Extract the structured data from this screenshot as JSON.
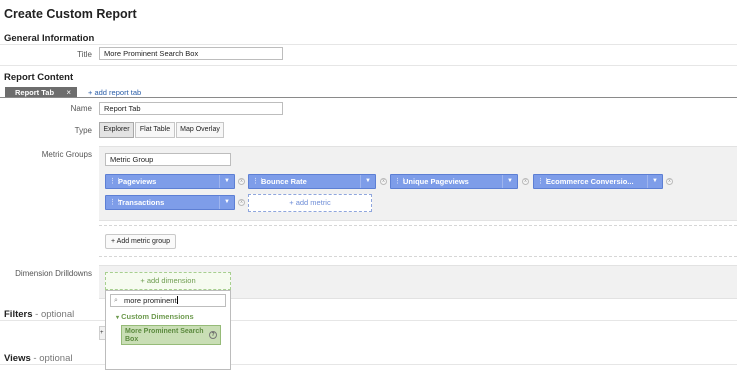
{
  "page": {
    "title": "Create Custom Report"
  },
  "general": {
    "heading": "General Information",
    "title_label": "Title",
    "title_value": "More Prominent Search Box"
  },
  "content": {
    "heading": "Report Content",
    "tabs": [
      {
        "label": "Report Tab",
        "close": "×"
      }
    ],
    "add_tab": "+ add report tab",
    "name_label": "Name",
    "name_value": "Report Tab",
    "type_label": "Type",
    "types": [
      {
        "label": "Explorer",
        "selected": true
      },
      {
        "label": "Flat Table",
        "selected": false
      },
      {
        "label": "Map Overlay",
        "selected": false
      }
    ],
    "metric_groups_label": "Metric Groups",
    "metric_group_name": "Metric Group",
    "metrics": [
      "Pageviews",
      "Bounce Rate",
      "Unique Pageviews",
      "Ecommerce Conversio...",
      "Transactions"
    ],
    "add_metric": "+ add metric",
    "add_metric_group": "+ Add metric group",
    "dimension_label": "Dimension Drilldowns",
    "add_dimension": "+ add dimension",
    "dimension_search_value": "more prominent",
    "dimension_category": "Custom Dimensions",
    "dimension_option": "More Prominent Search Box"
  },
  "filters": {
    "heading": "Filters",
    "optional": " - optional"
  },
  "views": {
    "heading": "Views",
    "optional": " - optional"
  },
  "icons": {
    "remove": "remove-icon",
    "dropdown": "chevron-down-icon",
    "drag": "drag-handle-icon",
    "search": "search-icon",
    "info": "info-icon",
    "collapse": "triangle-down-icon"
  },
  "colors": {
    "metric_chip": "#7e9de9",
    "dimension_green": "#6f9d51",
    "tab_grey": "#6d6d6d",
    "link_blue": "#2b5ea8"
  }
}
